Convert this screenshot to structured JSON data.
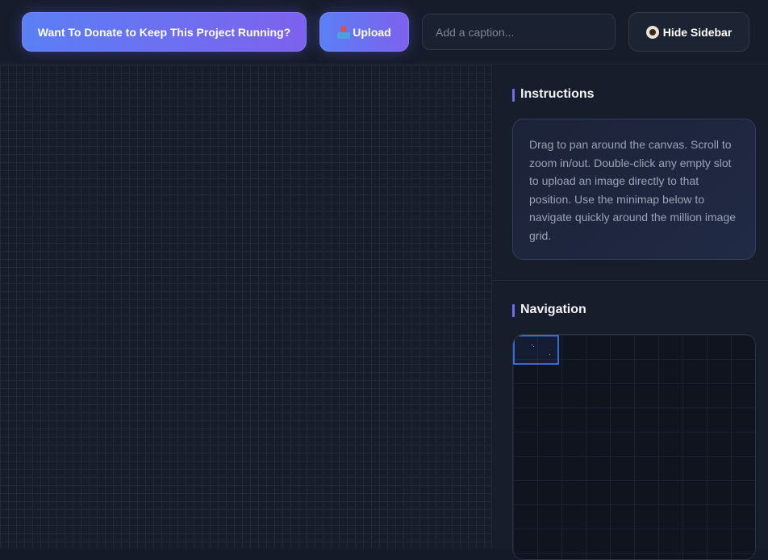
{
  "topbar": {
    "donate_label": "Want To Donate to Keep This Project Running?",
    "upload_label": "Upload",
    "upload_icon": "inbox-tray-icon",
    "caption_placeholder": "Add a caption...",
    "caption_value": "",
    "hide_sidebar_label": "Hide Sidebar",
    "hide_sidebar_icon": "eye-icon"
  },
  "sidebar": {
    "instructions": {
      "title": "Instructions",
      "text": "Drag to pan around the canvas. Scroll to zoom in/out. Double-click any empty slot to upload an image directly to that position. Use the minimap below to navigate quickly around the million image grid."
    },
    "navigation": {
      "title": "Navigation"
    }
  },
  "colors": {
    "accent_gradient_start": "#5b7ff5",
    "accent_gradient_end": "#7d62ee",
    "section_marker": "#6b6ff2",
    "viewport_border": "#3a6ad8",
    "background": "#141a27"
  }
}
